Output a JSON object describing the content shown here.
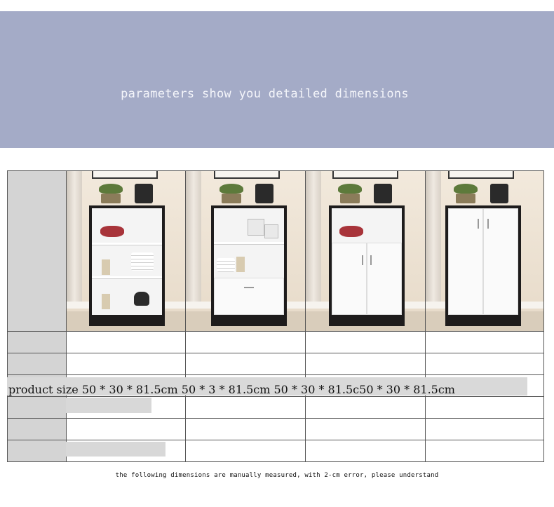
{
  "banner": {
    "text": "parameters show you detailed dimensions",
    "color": "#a4abc7"
  },
  "table": {
    "size_row_text": "product size 50 * 30 * 81.5cm 50 * 3 * 81.5cm 50 * 30 * 81.5c50 * 30 * 81.5cm",
    "products": [
      {
        "style": "open shelves"
      },
      {
        "style": "shelves with drawer"
      },
      {
        "style": "shelf with two doors"
      },
      {
        "style": "full two doors"
      }
    ]
  },
  "caption": "the following dimensions are manually measured, with 2-cm error, please understand"
}
